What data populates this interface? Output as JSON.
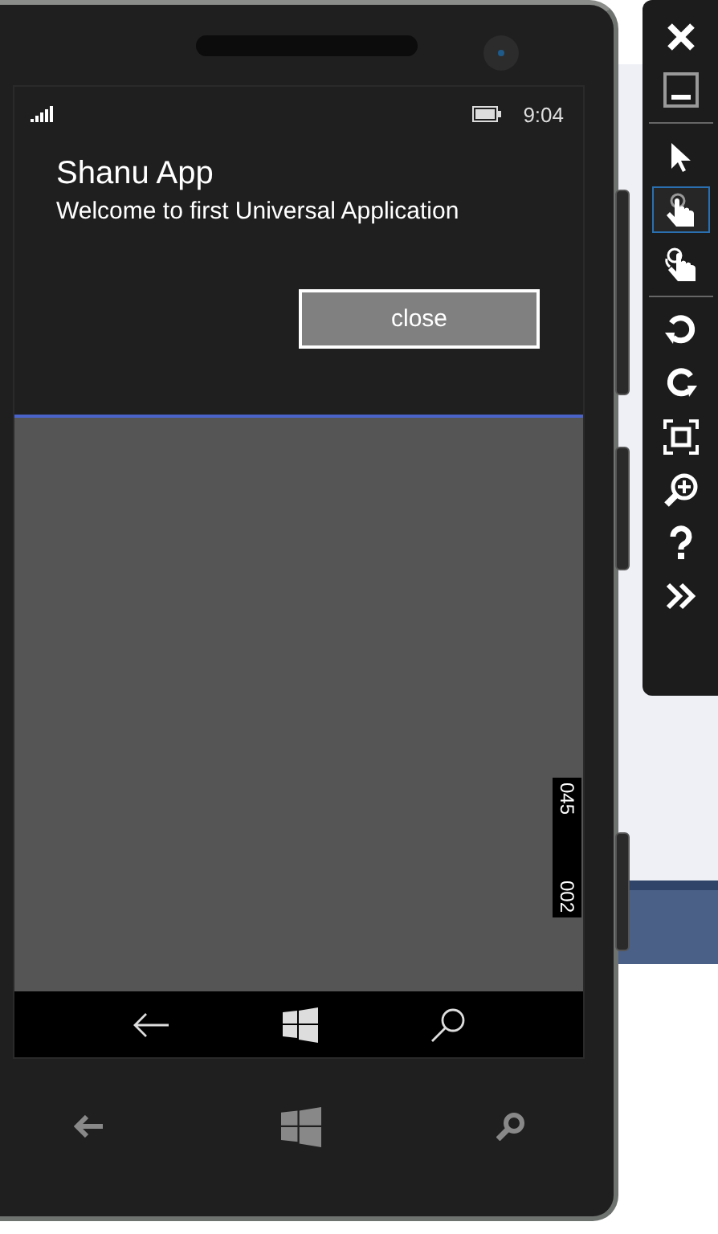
{
  "status_bar": {
    "time": "9:04"
  },
  "app": {
    "title": "Shanu App",
    "subtitle": "Welcome to first Universal Application",
    "button": "close"
  },
  "frame_counter": [
    "045",
    "002"
  ],
  "tools": [
    {
      "kind": "close",
      "selected": false
    },
    {
      "kind": "minimize",
      "selected": false
    },
    {
      "kind": "separator"
    },
    {
      "kind": "pointer",
      "selected": false
    },
    {
      "kind": "touch",
      "selected": true
    },
    {
      "kind": "multitouch",
      "selected": false
    },
    {
      "kind": "separator"
    },
    {
      "kind": "rotate-left",
      "selected": false
    },
    {
      "kind": "rotate-right",
      "selected": false
    },
    {
      "kind": "fit",
      "selected": false
    },
    {
      "kind": "zoom",
      "selected": false
    },
    {
      "kind": "help",
      "selected": false
    },
    {
      "kind": "more",
      "selected": false
    }
  ]
}
